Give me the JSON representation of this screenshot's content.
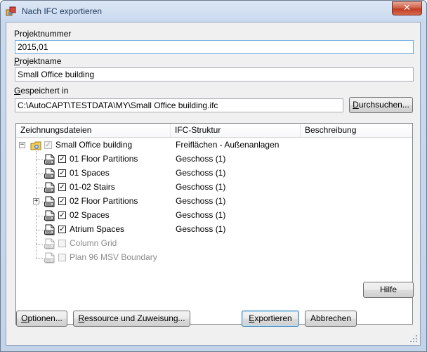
{
  "window": {
    "title": "Nach IFC exportieren",
    "close_glyph": "✕"
  },
  "project_number": {
    "label": "Projektnummer",
    "value": "2015,01"
  },
  "project_name": {
    "label_first": "P",
    "label_rest": "rojektname",
    "value": "Small Office building"
  },
  "saved_in": {
    "label_first": "G",
    "label_rest": "espeichert in",
    "value": "C:\\AutoCAPT\\TESTDATA\\MY\\Small Office building.ifc",
    "browse_first": "D",
    "browse_rest": "urchsuchen..."
  },
  "columns": [
    "Zeichnungsdateien",
    "IFC-Struktur",
    "Beschreibung"
  ],
  "tree": {
    "root": {
      "name": "Small Office building",
      "ifc": "Freiflächen - Außenanlagen",
      "checked": true,
      "icon": "project-folder-icon"
    },
    "items": [
      {
        "name": "01 Floor Partitions",
        "ifc": "Geschoss (1)",
        "checked": true,
        "enabled": true,
        "expandable": false,
        "icon": "dwg-file-icon"
      },
      {
        "name": "01 Spaces",
        "ifc": "Geschoss (1)",
        "checked": true,
        "enabled": true,
        "expandable": false,
        "icon": "dwg-file-icon"
      },
      {
        "name": "01-02 Stairs",
        "ifc": "Geschoss (1)",
        "checked": true,
        "enabled": true,
        "expandable": false,
        "icon": "dwg-file-icon"
      },
      {
        "name": "02 Floor Partitions",
        "ifc": "Geschoss (1)",
        "checked": true,
        "enabled": true,
        "expandable": true,
        "icon": "dwg-file-icon"
      },
      {
        "name": "02 Spaces",
        "ifc": "Geschoss (1)",
        "checked": true,
        "enabled": true,
        "expandable": false,
        "icon": "dwg-file-icon"
      },
      {
        "name": "Atrium Spaces",
        "ifc": "Geschoss (1)",
        "checked": true,
        "enabled": true,
        "expandable": false,
        "icon": "dwg-file-icon"
      },
      {
        "name": "Column Grid",
        "ifc": "",
        "checked": false,
        "enabled": false,
        "expandable": false,
        "icon": "dwg-file-icon"
      },
      {
        "name": "Plan 96 MSV Boundary",
        "ifc": "",
        "checked": false,
        "enabled": false,
        "expandable": false,
        "icon": "dwg-file-icon"
      }
    ]
  },
  "buttons": {
    "help": "Hilfe",
    "options_first": "O",
    "options_rest": "ptionen...",
    "resource_first": "R",
    "resource_rest": "essource und Zuweisung...",
    "export_first": "E",
    "export_rest": "xportieren",
    "cancel": "Abbrechen"
  },
  "colors": {
    "accent": "#3c7fb1",
    "close": "#c23c25",
    "disabled_text": "#8d8d8d"
  }
}
